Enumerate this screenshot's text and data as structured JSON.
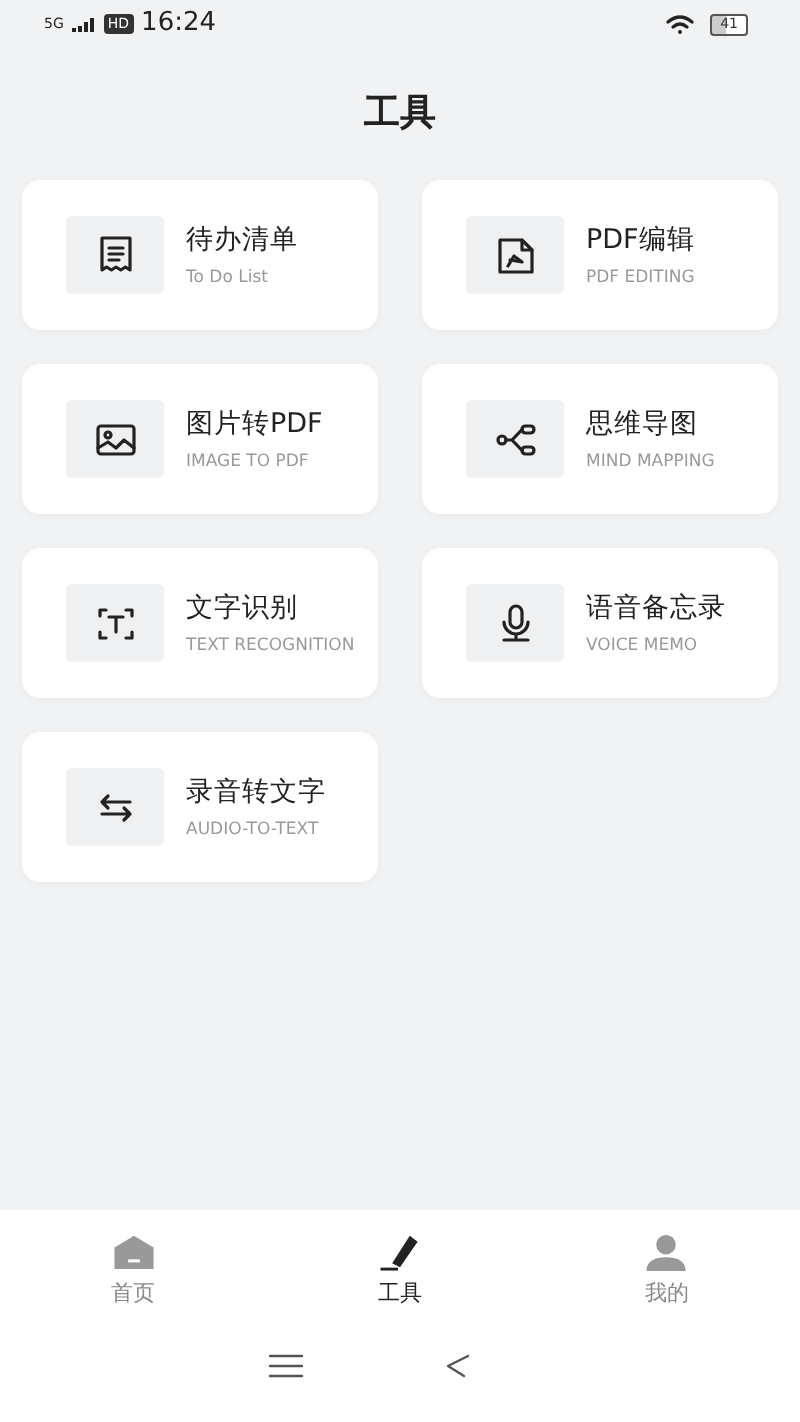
{
  "status_bar": {
    "network": "5G",
    "hd": "HD",
    "time": "16:24",
    "battery": "41"
  },
  "title": "工具",
  "tools": [
    {
      "kind": "receipt",
      "title": "待办清单",
      "subtitle": "To Do List"
    },
    {
      "kind": "pdf",
      "title": "PDF编辑",
      "subtitle": "PDF EDITING"
    },
    {
      "kind": "image",
      "title": "图片转PDF",
      "subtitle": "IMAGE TO PDF"
    },
    {
      "kind": "mindmap",
      "title": "思维导图",
      "subtitle": "MIND MAPPING"
    },
    {
      "kind": "scan",
      "title": "文字识别",
      "subtitle": "TEXT RECOGNITION"
    },
    {
      "kind": "mic",
      "title": "语音备忘录",
      "subtitle": "VOICE MEMO"
    },
    {
      "kind": "swap",
      "title": "录音转文字",
      "subtitle": "AUDIO-TO-TEXT"
    }
  ],
  "tabs": [
    {
      "kind": "home",
      "label": "首页",
      "selected": false
    },
    {
      "kind": "pen",
      "label": "工具",
      "selected": true
    },
    {
      "kind": "person",
      "label": "我的",
      "selected": false
    }
  ]
}
